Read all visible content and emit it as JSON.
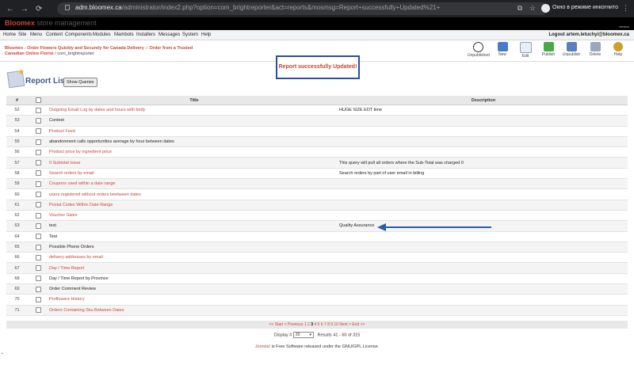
{
  "browser": {
    "url_host": "adm.bloomex.ca",
    "url_path": "/administrator/index2.php?option=com_brightreporter&act=reports&mosmsg=Report+successfully+Updated%21+",
    "incognito_label": "Окно в режиме инкогнито"
  },
  "app": {
    "brand": "Bloomex",
    "brand_suffix": "store management",
    "version": "version"
  },
  "menu": {
    "items": [
      "Home",
      "Site",
      "Menu",
      "Content",
      "Components",
      "Modules",
      "Mambots",
      "Installers",
      "Messages",
      "System",
      "Help"
    ],
    "logout": "Logout artem.letuchyi@bloomex.ca"
  },
  "pathway": {
    "site": "Bloomex - Order Flowers Quickly and Securely for Canada Delivery :: Order from a Trusted Canadian Online Florist",
    "separator": " / ",
    "component": "com_brightreporter"
  },
  "toolbar": {
    "buttons": [
      {
        "label": "Unpublished",
        "icon": "unpublish-eye-icon",
        "color": "#333333"
      },
      {
        "label": "New",
        "icon": "new-icon",
        "color": "#4a7cc9"
      },
      {
        "label": "Edit",
        "icon": "edit-icon",
        "color": "#e8eef8"
      },
      {
        "label": "Publish",
        "icon": "publish-icon",
        "color": "#4aa84a"
      },
      {
        "label": "Unpublish",
        "icon": "unpublish-icon",
        "color": "#5a7fbf"
      },
      {
        "label": "Delete",
        "icon": "delete-icon",
        "color": "#9aa7bd"
      },
      {
        "label": "Help",
        "icon": "help-icon",
        "color": "#c9a227"
      }
    ]
  },
  "message": "Report successfully Updated!",
  "page": {
    "title": "Report List",
    "show_queries": "Show Queries"
  },
  "table": {
    "headers": {
      "num": "#",
      "title": "Title",
      "description": "Description"
    },
    "rows": [
      {
        "num": "52",
        "title": "Outgoing Email Log by dates and hours with body",
        "link": true,
        "description": "HUGE SIZE EDT time"
      },
      {
        "num": "53",
        "title": "Contest",
        "link": false,
        "description": ""
      },
      {
        "num": "54",
        "title": "Product Feed",
        "link": true,
        "description": ""
      },
      {
        "num": "55",
        "title": "abandonment calls opportunities average by hour between dates",
        "link": false,
        "description": ""
      },
      {
        "num": "56",
        "title": "Product price by ingredient price",
        "link": true,
        "description": ""
      },
      {
        "num": "57",
        "title": "0 Subtotal Issue",
        "link": true,
        "description": "This query will pull all orders where the Sub-Total was charged 0"
      },
      {
        "num": "58",
        "title": "Search orders by email",
        "link": true,
        "description": "Search orders by part of user email in billing"
      },
      {
        "num": "59",
        "title": "Coupons used within a date range",
        "link": true,
        "description": ""
      },
      {
        "num": "60",
        "title": "users registered without orders beetween dates",
        "link": true,
        "description": ""
      },
      {
        "num": "61",
        "title": "Postal Codes Within Date Range",
        "link": true,
        "description": ""
      },
      {
        "num": "62",
        "title": "Voucher Sales",
        "link": true,
        "description": ""
      },
      {
        "num": "63",
        "title": "test",
        "link": false,
        "description": "Quality Assurance"
      },
      {
        "num": "64",
        "title": "Test",
        "link": false,
        "description": ""
      },
      {
        "num": "65",
        "title": "Possible Phone Orders",
        "link": false,
        "description": ""
      },
      {
        "num": "66",
        "title": "delivery addresses by email",
        "link": true,
        "description": ""
      },
      {
        "num": "67",
        "title": "Day / Time Report",
        "link": true,
        "description": ""
      },
      {
        "num": "68",
        "title": "Day / Time Report by Province",
        "link": false,
        "description": ""
      },
      {
        "num": "69",
        "title": "Order Comment Review",
        "link": false,
        "description": ""
      },
      {
        "num": "70",
        "title": "Proflowers History",
        "link": true,
        "description": ""
      },
      {
        "num": "71",
        "title": "Orders Containing Sku Between Dates",
        "link": true,
        "description": ""
      }
    ]
  },
  "pagination": {
    "start": "<< Start",
    "previous": "< Previous",
    "pages": [
      "1",
      "2",
      "3",
      "4",
      "5",
      "6",
      "7",
      "8",
      "9",
      "10"
    ],
    "current": "3",
    "next": "Next >",
    "end": "End >>"
  },
  "display": {
    "label": "Display #",
    "value": "20",
    "results": "Results 41 - 60 of 315"
  },
  "footer": {
    "link": "Joomla!",
    "text": " is Free Software released under the GNU/GPL License."
  },
  "colors": {
    "accent": "#c64934",
    "header_bg": "#000000",
    "highlight_border": "#2b4fa5",
    "arrow": "#2b5ca8"
  }
}
